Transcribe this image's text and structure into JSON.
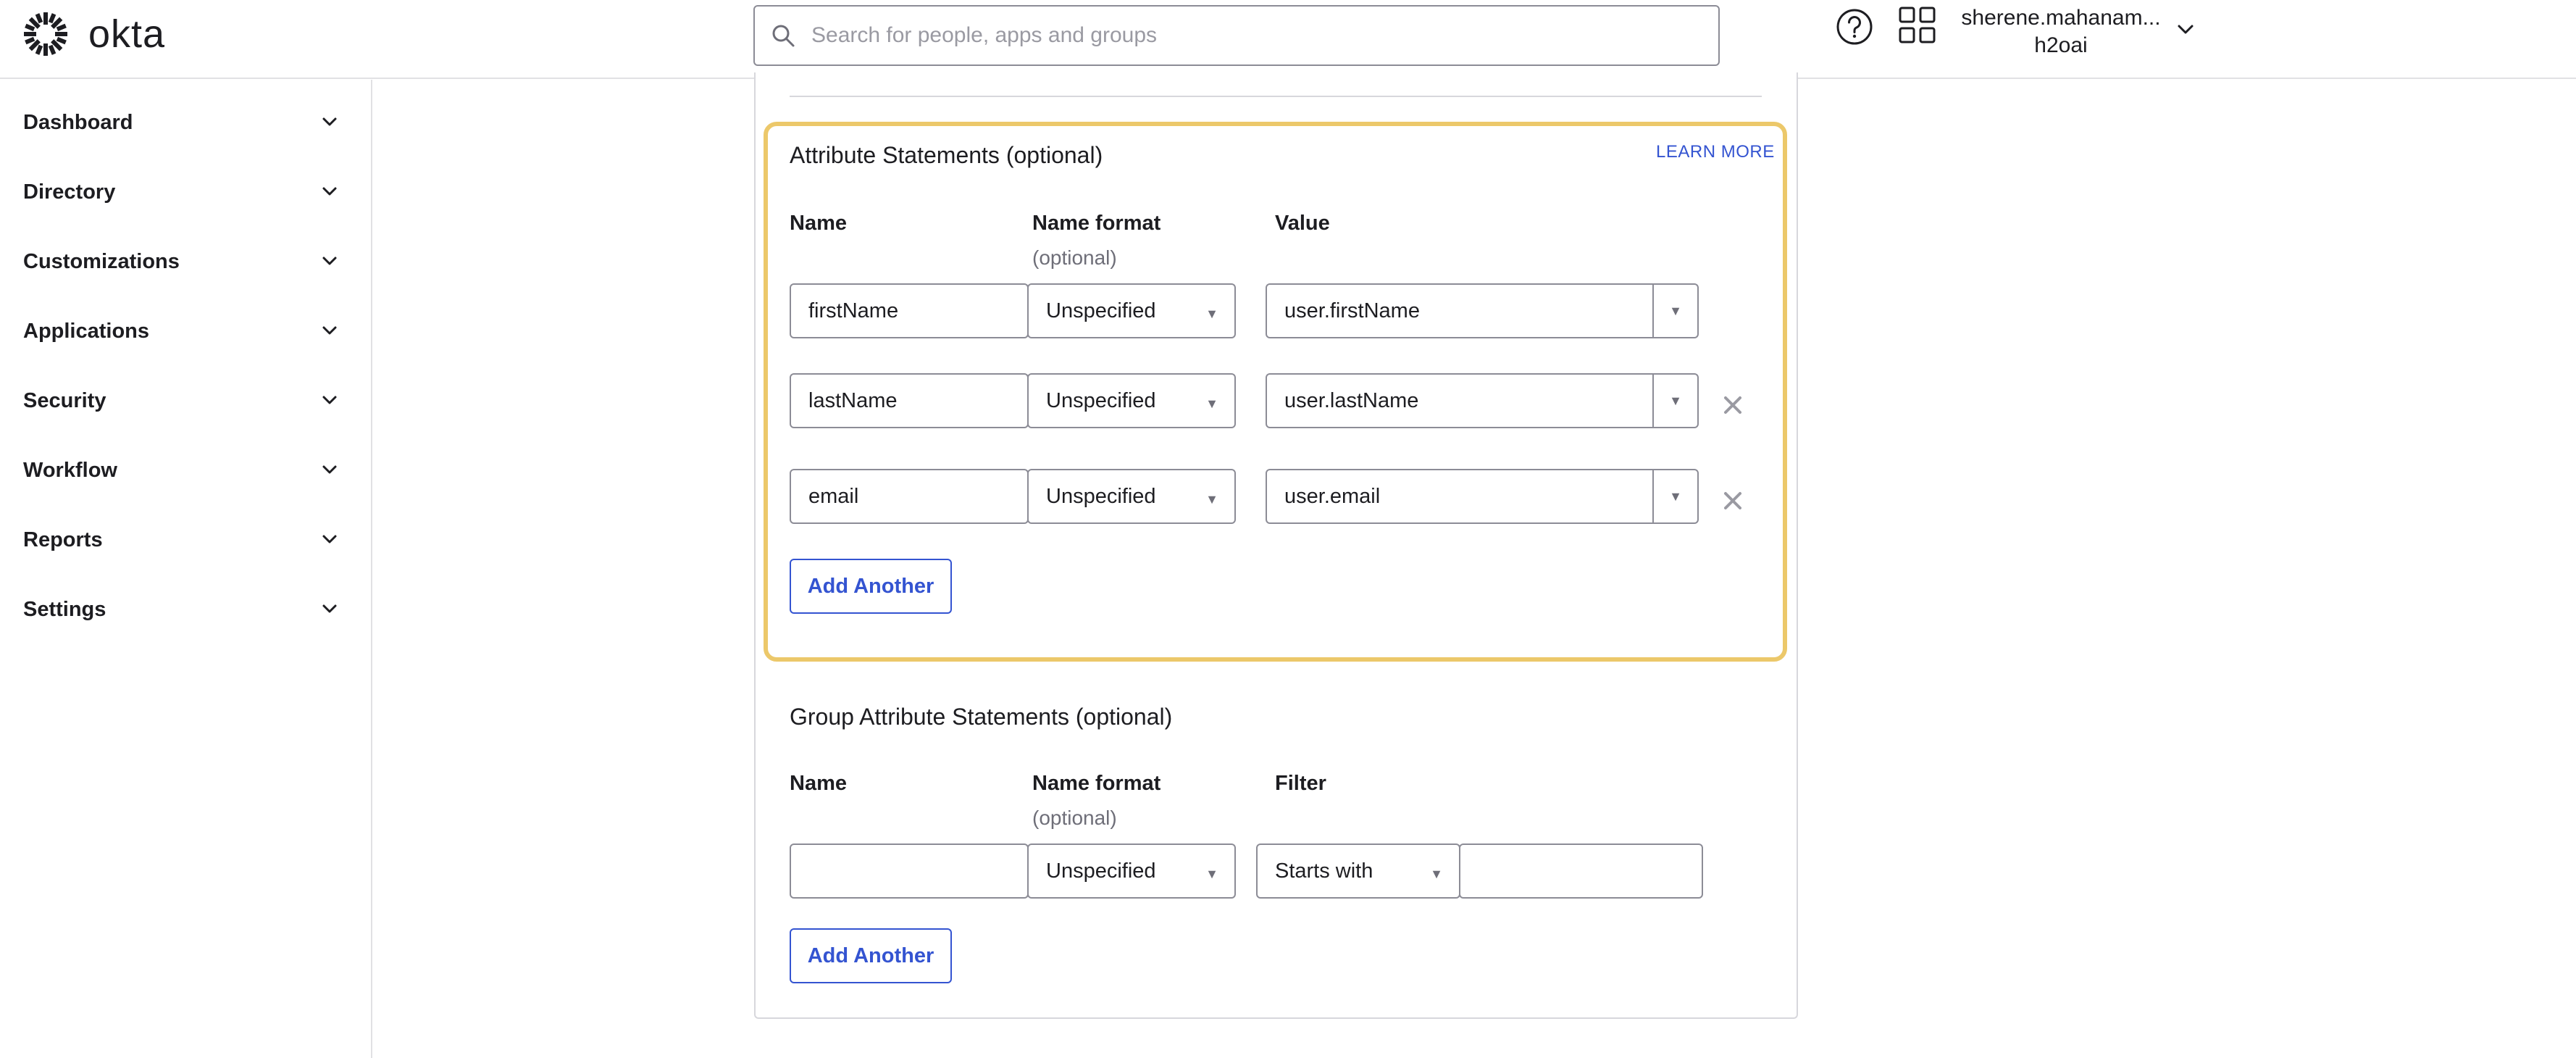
{
  "header": {
    "brand": "okta",
    "search_placeholder": "Search for people, apps and groups",
    "user_name": "sherene.mahanam...",
    "user_org": "h2oai"
  },
  "sidebar": {
    "items": [
      {
        "label": "Dashboard"
      },
      {
        "label": "Directory"
      },
      {
        "label": "Customizations"
      },
      {
        "label": "Applications"
      },
      {
        "label": "Security"
      },
      {
        "label": "Workflow"
      },
      {
        "label": "Reports"
      },
      {
        "label": "Settings"
      }
    ]
  },
  "attributes": {
    "title": "Attribute Statements (optional)",
    "learn_more": "LEARN MORE",
    "col_name": "Name",
    "col_format": "Name format",
    "col_format_sub": "(optional)",
    "col_value": "Value",
    "rows": [
      {
        "name": "firstName",
        "format": "Unspecified",
        "value": "user.firstName"
      },
      {
        "name": "lastName",
        "format": "Unspecified",
        "value": "user.lastName"
      },
      {
        "name": "email",
        "format": "Unspecified",
        "value": "user.email"
      }
    ],
    "add_label": "Add Another"
  },
  "group_attributes": {
    "title": "Group Attribute Statements (optional)",
    "col_name": "Name",
    "col_format": "Name format",
    "col_format_sub": "(optional)",
    "col_filter": "Filter",
    "row": {
      "name": "",
      "format": "Unspecified",
      "filter_type": "Starts with",
      "filter_value": ""
    },
    "add_label": "Add Another"
  },
  "colors": {
    "accent": "#3454d1",
    "highlight_border": "#ecc86a",
    "text": "#1d1d21",
    "muted": "#6e6e78"
  }
}
